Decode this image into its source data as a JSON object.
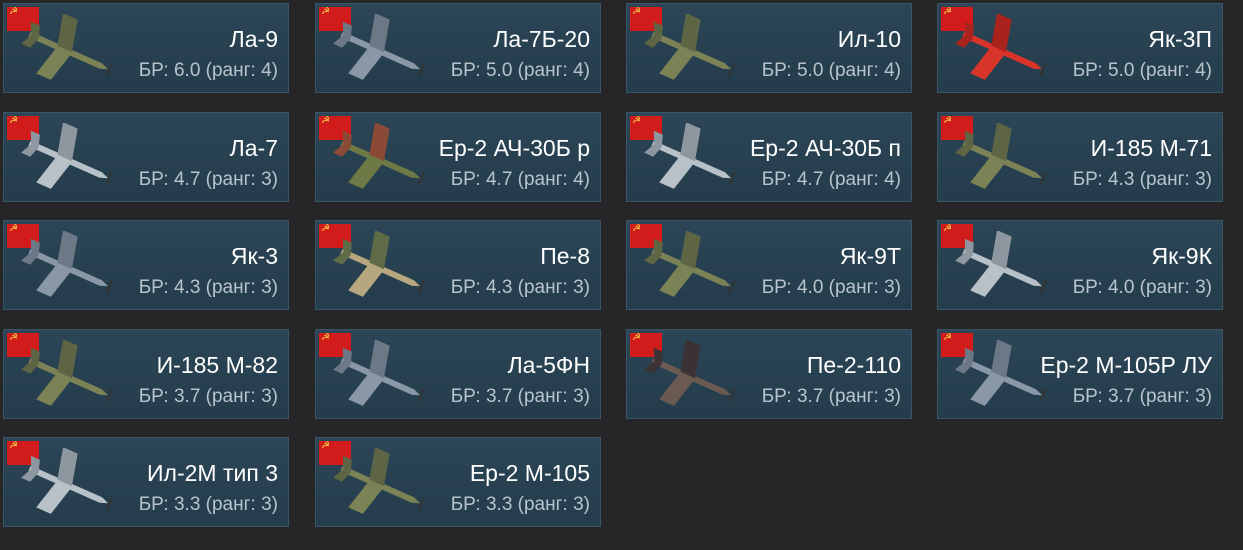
{
  "colors": {
    "background": "#262628",
    "card": "#284150",
    "flag": "#d21b1b",
    "emblem": "#f3d34a"
  },
  "icons": {
    "flag": "ussr-flag-icon",
    "plane": "aircraft-icon"
  },
  "vehicles": [
    {
      "name": "Ла-9",
      "br": "БР: 6.0 (ранг: 4)",
      "camo": "olive"
    },
    {
      "name": "Ла-7Б-20",
      "br": "БР: 5.0 (ранг: 4)",
      "camo": "grey"
    },
    {
      "name": "Ил-10",
      "br": "БР: 5.0 (ранг: 4)",
      "camo": "olive"
    },
    {
      "name": "Як-3П",
      "br": "БР: 5.0 (ранг: 4)",
      "camo": "red"
    },
    {
      "name": "Ла-7",
      "br": "БР: 4.7 (ранг: 3)",
      "camo": "light"
    },
    {
      "name": "Ер-2 АЧ-30Б р",
      "br": "БР: 4.7 (ранг: 4)",
      "camo": "green"
    },
    {
      "name": "Ер-2 АЧ-30Б п",
      "br": "БР: 4.7 (ранг: 4)",
      "camo": "light"
    },
    {
      "name": "И-185 М-71",
      "br": "БР: 4.3 (ранг: 3)",
      "camo": "olive"
    },
    {
      "name": "Як-3",
      "br": "БР: 4.3 (ранг: 3)",
      "camo": "grey"
    },
    {
      "name": "Пе-8",
      "br": "БР: 4.3 (ранг: 3)",
      "camo": "tan"
    },
    {
      "name": "Як-9Т",
      "br": "БР: 4.0 (ранг: 3)",
      "camo": "olive"
    },
    {
      "name": "Як-9К",
      "br": "БР: 4.0 (ранг: 3)",
      "camo": "light"
    },
    {
      "name": "И-185 М-82",
      "br": "БР: 3.7 (ранг: 3)",
      "camo": "olive"
    },
    {
      "name": "Ла-5ФН",
      "br": "БР: 3.7 (ранг: 3)",
      "camo": "grey"
    },
    {
      "name": "Пе-2-110",
      "br": "БР: 3.7 (ранг: 3)",
      "camo": "brown"
    },
    {
      "name": "Ер-2 М-105Р ЛУ",
      "br": "БР: 3.7 (ранг: 3)",
      "camo": "grey"
    },
    {
      "name": "Ил-2М тип 3",
      "br": "БР: 3.3 (ранг: 3)",
      "camo": "light"
    },
    {
      "name": "Ер-2 М-105",
      "br": "БР: 3.3 (ранг: 3)",
      "camo": "olive"
    }
  ]
}
